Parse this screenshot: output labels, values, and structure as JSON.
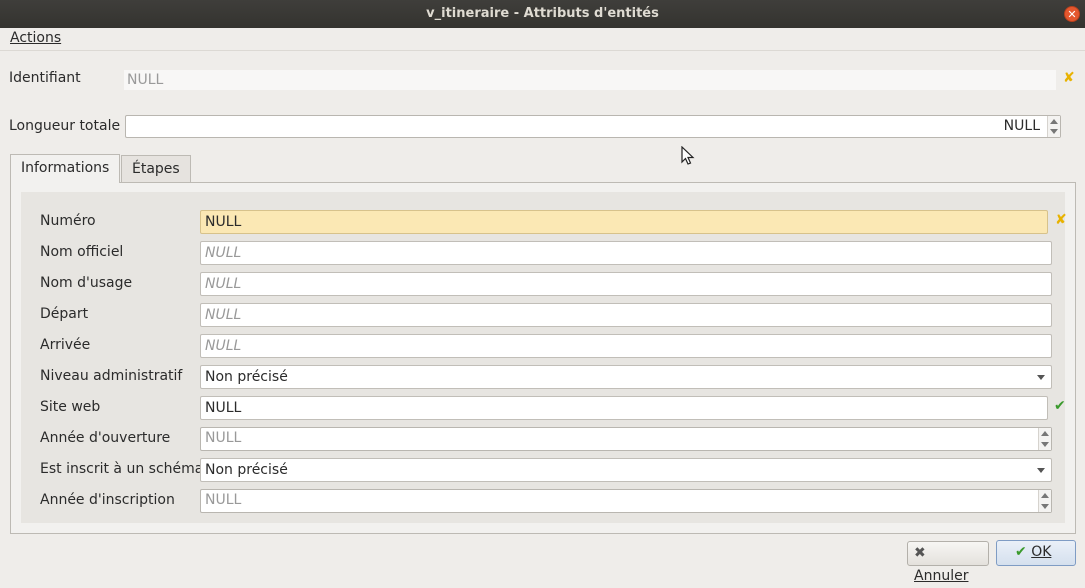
{
  "window": {
    "title": "v_itineraire - Attributs d'entités"
  },
  "menu": {
    "actions_label": "Actions"
  },
  "header_fields": {
    "identifiant": {
      "label": "Identifiant",
      "value": "NULL"
    },
    "longueur": {
      "label": "Longueur totale",
      "value": "NULL"
    }
  },
  "tabs": [
    {
      "label": "Informations"
    },
    {
      "label": "Étapes"
    }
  ],
  "form": {
    "rows": [
      {
        "label": "Numéro",
        "value": "NULL"
      },
      {
        "label": "Nom officiel",
        "value": "NULL"
      },
      {
        "label": "Nom d'usage",
        "value": "NULL"
      },
      {
        "label": "Départ",
        "value": "NULL"
      },
      {
        "label": "Arrivée",
        "value": "NULL"
      },
      {
        "label": "Niveau administratif",
        "value": "Non précisé"
      },
      {
        "label": "Site web",
        "value": "NULL"
      },
      {
        "label": "Année d'ouverture",
        "value": "NULL"
      },
      {
        "label": "Est inscrit à un schéma",
        "value": "Non précisé"
      },
      {
        "label": "Année d'inscription",
        "value": "NULL"
      }
    ]
  },
  "buttons": {
    "cancel": "Annuler",
    "ok": "OK"
  },
  "icons": {
    "close": "close-icon",
    "clear": "clear-x-icon",
    "valid": "checkmark-icon",
    "cancel": "cross-icon",
    "ok": "check-icon",
    "cursor": "mouse-pointer-icon"
  },
  "colors": {
    "required_highlight": "#fbe8b4",
    "clear_icon": "#e8b200",
    "valid_icon": "#3a9a2c"
  }
}
